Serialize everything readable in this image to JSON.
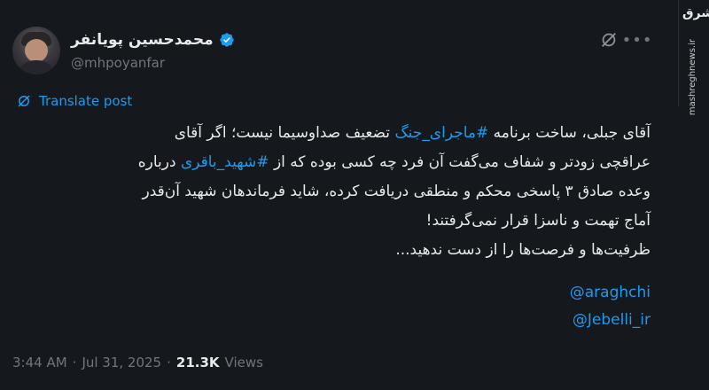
{
  "author": {
    "name": "محمدحسین پویانفر",
    "handle": "@mhpoyanfar"
  },
  "translate_label": "Translate post",
  "tweet": {
    "line1_a": "آقای جبلی، ساخت برنامه ",
    "hashtag1": "#ماجرای_جنگ",
    "line1_b": " تضعیف صداوسیما نیست؛ اگر آقای",
    "line2_a": "عراقچی زودتر و شفاف می‌گفت آن فرد چه کسی بوده که از ",
    "hashtag2": "#شهید_باقری",
    "line2_b": " درباره",
    "line3": "وعده صادق ۳ پاسخی محکم و منطقی دریافت کرده، شاید فرماندهان شهید آن‌قدر",
    "line4": "آماج تهمت و ناسزا قرار نمی‌گرفتند!",
    "line5": "ظرفیت‌ها و فرصت‌ها را از دست ندهید..."
  },
  "mentions": [
    "@araghchi",
    "@Jebelli_ir"
  ],
  "meta": {
    "time": "3:44 AM",
    "sep1": "·",
    "date": "Jul 31, 2025",
    "sep2": "·",
    "views_count": "21.3K",
    "views_label": "Views"
  },
  "watermark": {
    "logo": "مشرق",
    "site": "mashreghnews.ir"
  },
  "colors": {
    "background": "#15181c",
    "accent": "#1d9bf0",
    "muted": "#71767b",
    "text": "#e7e9ea"
  },
  "icons": [
    "verified-badge-icon",
    "grok-icon",
    "more-icon",
    "translate-icon"
  ]
}
